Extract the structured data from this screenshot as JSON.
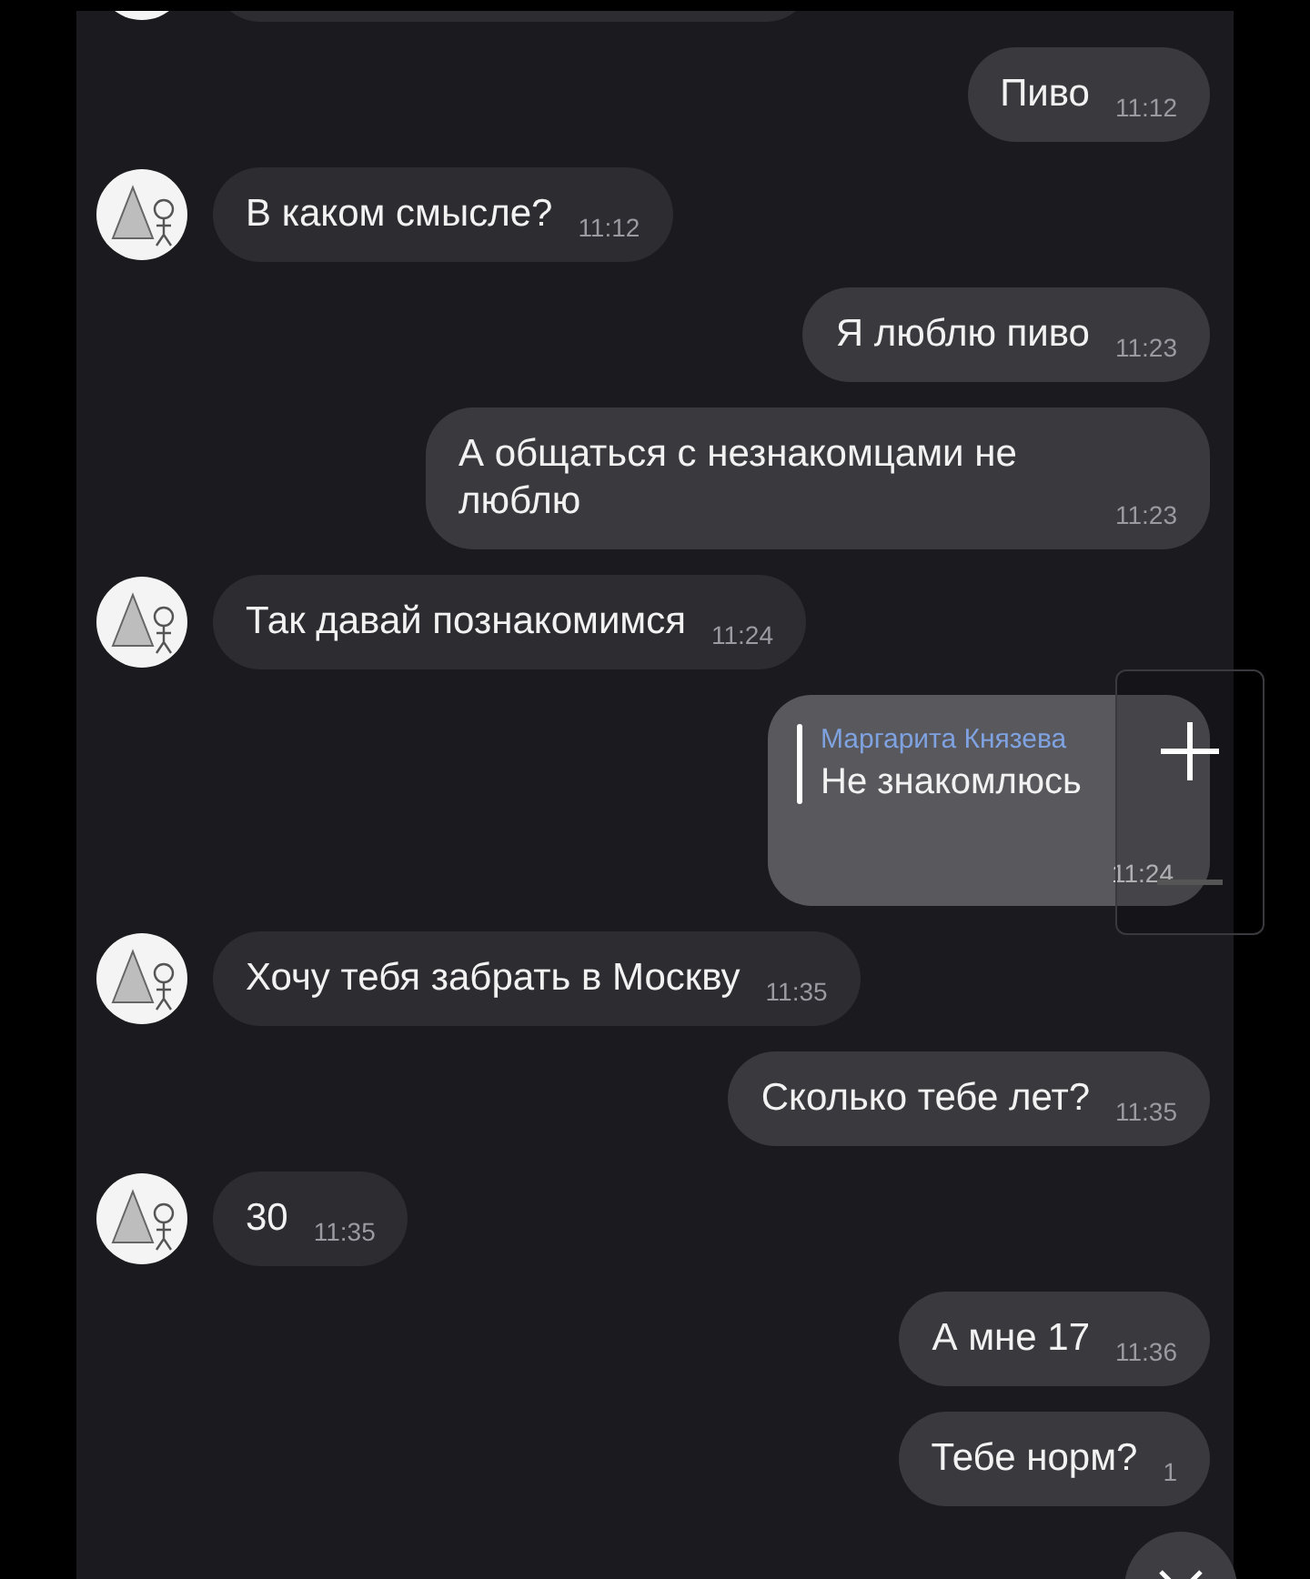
{
  "messages": [
    {
      "kind": "clipped",
      "outgoing": false
    },
    {
      "kind": "text",
      "outgoing": true,
      "text": "Пиво",
      "time": "11:12"
    },
    {
      "kind": "text",
      "outgoing": false,
      "text": "В каком смысле?",
      "time": "11:12"
    },
    {
      "kind": "text",
      "outgoing": true,
      "text": "Я люблю пиво",
      "time": "11:23"
    },
    {
      "kind": "text",
      "outgoing": true,
      "text": "А общаться с незнакомцами не люблю",
      "time": "11:23"
    },
    {
      "kind": "text",
      "outgoing": false,
      "text": "Так давай познакомимся",
      "time": "11:24"
    },
    {
      "kind": "reply",
      "outgoing": true,
      "reply": {
        "author": "Маргарита Князева",
        "text": "Не знакомлюсь"
      },
      "time": "11:24"
    },
    {
      "kind": "text",
      "outgoing": false,
      "text": "Хочу тебя забрать в Москву",
      "time": "11:35"
    },
    {
      "kind": "text",
      "outgoing": true,
      "text": "Сколько тебе лет?",
      "time": "11:35"
    },
    {
      "kind": "text",
      "outgoing": false,
      "text": "30",
      "time": "11:35"
    },
    {
      "kind": "text",
      "outgoing": true,
      "text": "А мне 17",
      "time": "11:36"
    },
    {
      "kind": "text",
      "outgoing": true,
      "text": "Тебе норм?",
      "time": "1"
    }
  ]
}
